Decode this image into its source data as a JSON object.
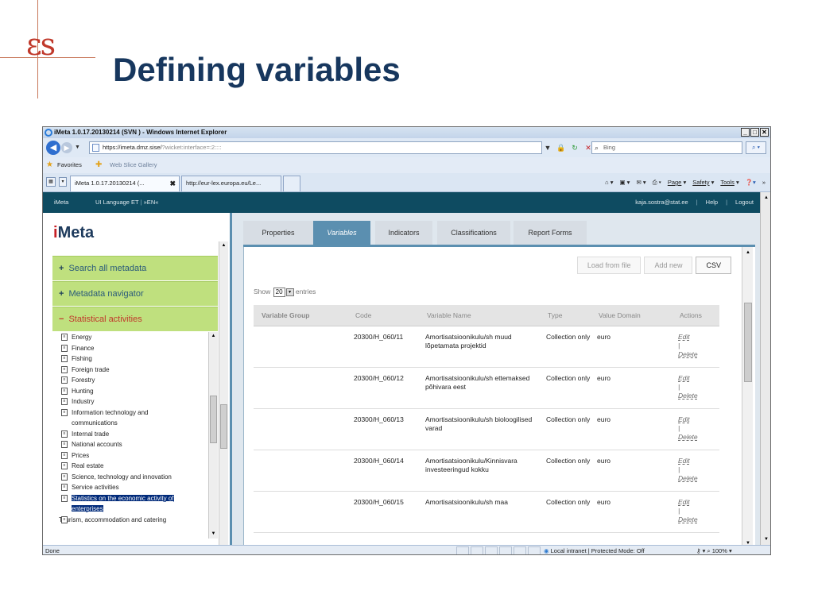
{
  "slide": {
    "logo": "ɛs",
    "title": "Defining variables"
  },
  "browser": {
    "title": "iMeta 1.0.17.20130214 (SVN ) - Windows Internet Explorer",
    "url_main": "https://imeta.dmz.sise/",
    "url_rest": "?wicket:interface=:2::::",
    "search_placeholder": "Bing",
    "favorites_label": "Favorites",
    "web_slice_gallery": "Web Slice Gallery",
    "tabs": [
      {
        "label": "iMeta 1.0.17.20130214 (...",
        "close": "✖"
      },
      {
        "label": "http://eur-lex.europa.eu/Le..."
      }
    ],
    "command_bar": {
      "page": "Page",
      "safety": "Safety",
      "tools": "Tools"
    },
    "status": {
      "done": "Done",
      "zone": "Local intranet | Protected Mode: Off",
      "zoom": "100%"
    }
  },
  "app": {
    "topbar": {
      "home": "iMeta",
      "ui_language": "UI Language ET",
      "lang_sel": "»EN«",
      "user": "kaja.sostra@stat.ee",
      "help": "Help",
      "logout": "Logout"
    },
    "logo_i": "i",
    "logo_rest": "Meta",
    "accordion": [
      {
        "sign": "+",
        "label": "Search all metadata"
      },
      {
        "sign": "+",
        "label": "Metadata navigator"
      },
      {
        "sign": "−",
        "label": "Statistical activities"
      }
    ],
    "categories": [
      "Energy",
      "Finance",
      "Fishing",
      "Foreign trade",
      "Forestry",
      "Hunting",
      "Industry",
      "Information technology and communications",
      "Internal trade",
      "National accounts",
      "Prices",
      "Real estate",
      "Science, technology and innovation",
      "Service activities"
    ],
    "selected_category": "Statistics on the economic activity of enterprises",
    "after_selected": "Tourism, accommodation and catering",
    "content_tabs": [
      "Properties",
      "Variables",
      "Indicators",
      "Classifications",
      "Report Forms"
    ],
    "buttons": {
      "load": "Load from file",
      "add": "Add new",
      "csv": "CSV"
    },
    "show": {
      "before": "Show",
      "value": "20",
      "after": "entries"
    },
    "columns": [
      "Variable Group",
      "Code",
      "Variable Name",
      "Type",
      "Value Domain",
      "Actions"
    ],
    "rows": [
      {
        "group": "",
        "code": "20300/H_060/11",
        "name": "Amortisatsioonikulu/sh muud lõpetamata projektid",
        "type": "Collection only",
        "domain": "euro",
        "edit": "Edit",
        "sep": "|",
        "delete": "Delete"
      },
      {
        "group": "",
        "code": "20300/H_060/12",
        "name": "Amortisatsioonikulu/sh ettemaksed põhivara eest",
        "type": "Collection only",
        "domain": "euro",
        "edit": "Edit",
        "sep": "|",
        "delete": "Delete"
      },
      {
        "group": "",
        "code": "20300/H_060/13",
        "name": "Amortisatsioonikulu/sh bioloogilised varad",
        "type": "Collection only",
        "domain": "euro",
        "edit": "Edit",
        "sep": "|",
        "delete": "Delete"
      },
      {
        "group": "",
        "code": "20300/H_060/14",
        "name": "Amortisatsioonikulu/Kinnisvara investeeringud kokku",
        "type": "Collection only",
        "domain": "euro",
        "edit": "Edit",
        "sep": "|",
        "delete": "Delete"
      },
      {
        "group": "",
        "code": "20300/H_060/15",
        "name": "Amortisatsioonikulu/sh maa",
        "type": "Collection only",
        "domain": "euro",
        "edit": "Edit",
        "sep": "|",
        "delete": "Delete"
      }
    ]
  },
  "colors": {
    "title": "#17375e",
    "app_bar": "#0e4b61",
    "accordion": "#bfe07e",
    "active_tab": "#5b8fb0",
    "logo_red": "#c62026"
  }
}
